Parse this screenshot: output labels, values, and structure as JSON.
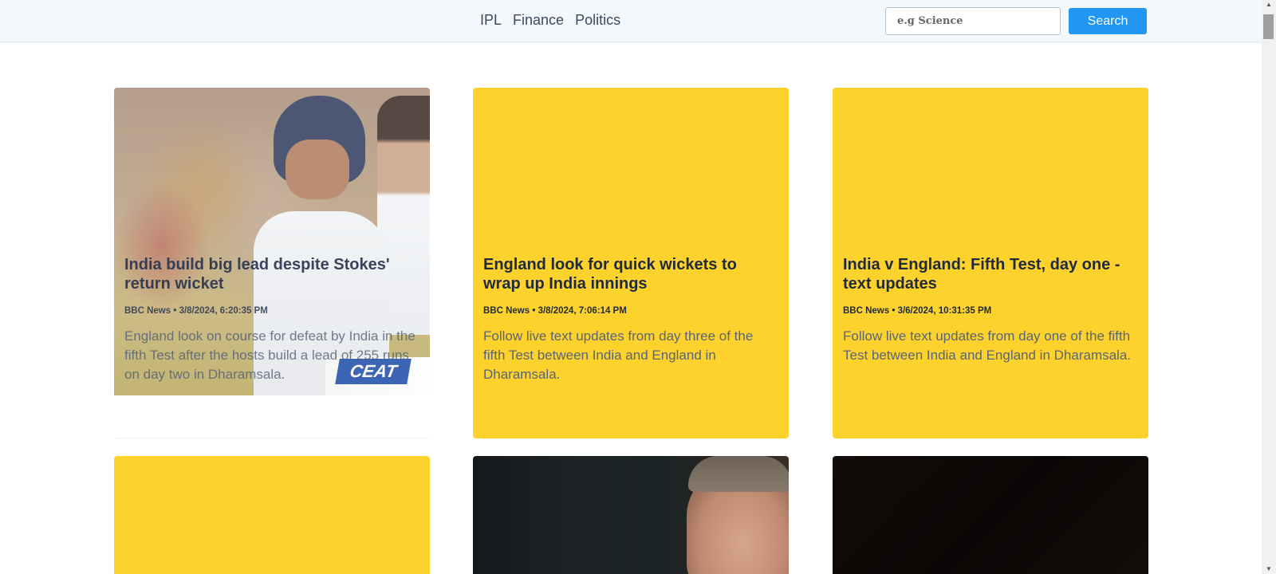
{
  "nav": {
    "links": [
      "IPL",
      "Finance",
      "Politics"
    ]
  },
  "search": {
    "placeholder": "e.g Science",
    "button_label": "Search"
  },
  "cards": [
    {
      "title": "India build big lead despite Stokes' return wicket",
      "meta": "BBC News • 3/8/2024, 6:20:35 PM",
      "description": "England look on course for defeat by India in the fifth Test after the hosts build a lead of 255 runs on day two in Dharamsala.",
      "image_logo_text": "CEAT"
    },
    {
      "title": "England look for quick wickets to wrap up India innings",
      "meta": "BBC News • 3/8/2024, 7:06:14 PM",
      "description": "Follow live text updates from day three of the fifth Test between India and England in Dharamsala."
    },
    {
      "title": "India v England: Fifth Test, day one - text updates",
      "meta": "BBC News • 3/6/2024, 10:31:35 PM",
      "description": "Follow live text updates from day one of the fifth Test between India and England in Dharamsala."
    }
  ],
  "colors": {
    "placeholder_card": "#fdd22c",
    "search_button": "#2196f3",
    "topbar": "#f3f8fc"
  }
}
